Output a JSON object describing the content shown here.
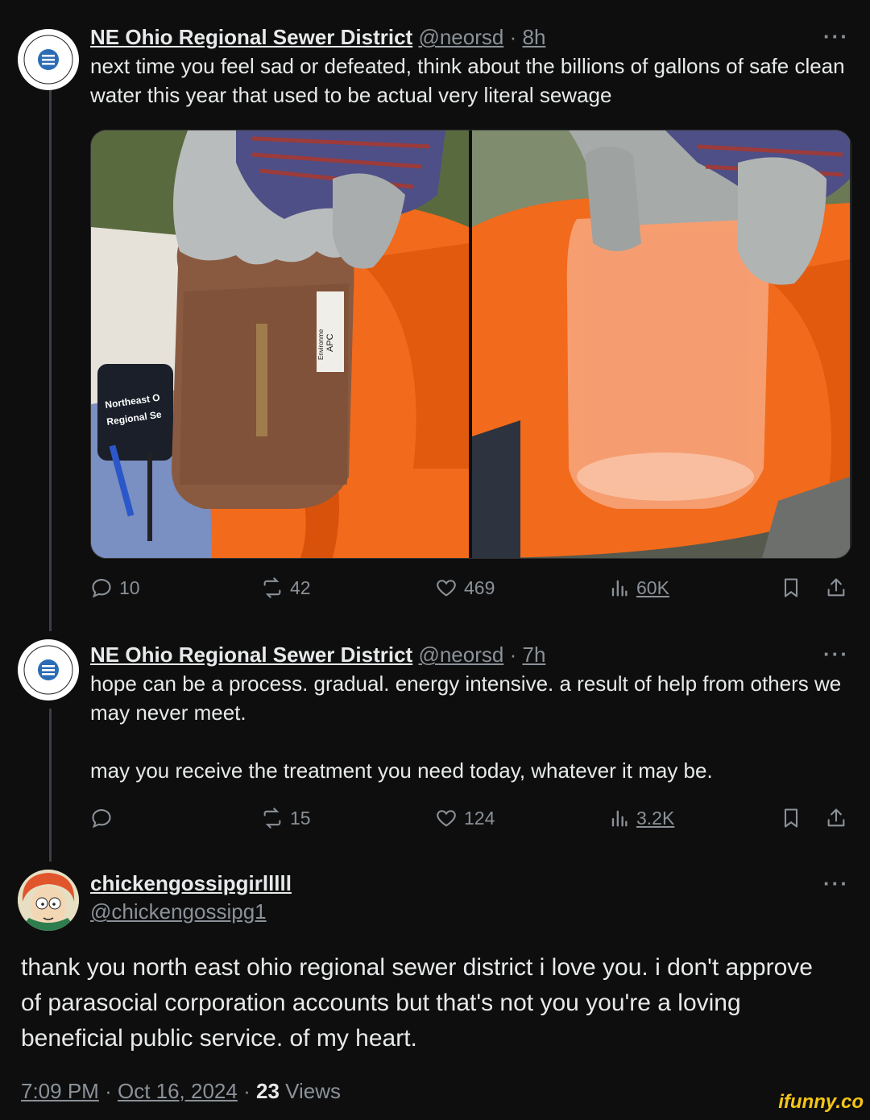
{
  "post1": {
    "author_name": "NE Ohio Regional Sewer District",
    "handle": "@neorsd",
    "separator": "·",
    "time": "8h",
    "more": "···",
    "text": "next time you feel sad or defeated, think about the billions of gallons of safe clean water this year that used to be actual very literal sewage",
    "media_labels": {
      "patch_line1": "Northeast O",
      "patch_line2": "Regional Se",
      "jar_label": "APC",
      "jar_label_small": "Environme"
    },
    "actions": {
      "replies": "10",
      "reposts": "42",
      "likes": "469",
      "views": "60K"
    }
  },
  "post2": {
    "author_name": "NE Ohio Regional Sewer District",
    "handle": "@neorsd",
    "separator": "·",
    "time": "7h",
    "more": "···",
    "text_p1": "hope can be a process. gradual. energy intensive. a result of help from others we may never meet.",
    "text_p2": "may you receive the treatment you need today, whatever it may be.",
    "actions": {
      "replies": "",
      "reposts": "15",
      "likes": "124",
      "views": "3.2K"
    }
  },
  "reply": {
    "display_name": "chickengossipgirlllll",
    "handle": "@chickengossipg1",
    "more": "···",
    "text": "thank you north east ohio regional sewer district i love you. i don't approve of parasocial corporation accounts but that's not you you're a loving beneficial public service. of my heart.",
    "time": "7:09 PM",
    "separator": "·",
    "date": "Oct 16, 2024",
    "views_count": "23",
    "views_label": "Views"
  },
  "watermark": "ifunny.co",
  "colors": {
    "background": "#0e0e0e",
    "text": "#e7e9ea",
    "muted": "#8b9198",
    "thread_line": "#3a3f45",
    "district_blue": "#2a6db5",
    "orange_vest": "#f26a1b"
  },
  "icons": [
    "reply-icon",
    "repost-icon",
    "like-icon",
    "views-icon",
    "bookmark-icon",
    "share-icon",
    "more-icon"
  ]
}
